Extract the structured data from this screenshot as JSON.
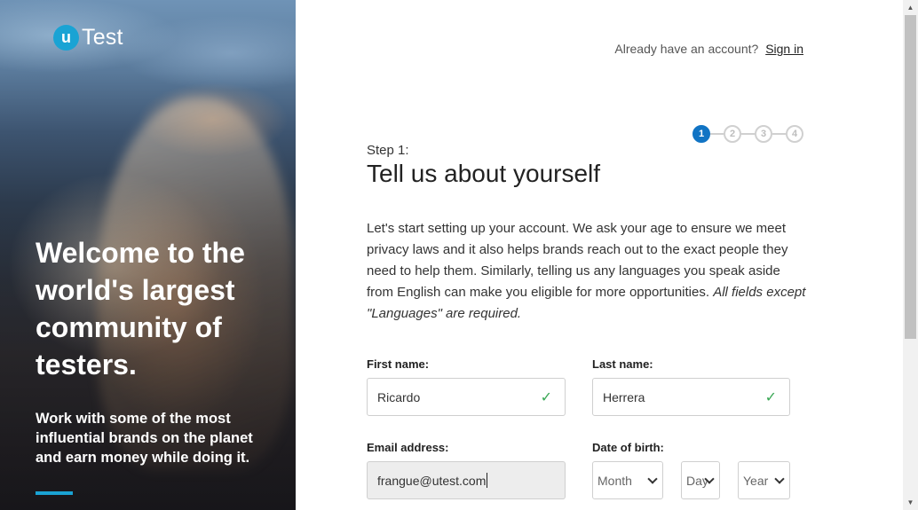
{
  "brand": {
    "logo_mark": "u",
    "logo_text": "Test",
    "accent_color": "#1aa3d4"
  },
  "hero": {
    "title": "Welcome to the world's largest community of testers.",
    "subtitle": "Work with some of the most influential brands on the planet and earn money while doing it."
  },
  "header": {
    "question": "Already have an account?",
    "sign_in": "Sign in"
  },
  "stepper": {
    "steps": [
      "1",
      "2",
      "3",
      "4"
    ],
    "current": 1,
    "active_color": "#1174c4"
  },
  "form": {
    "step_label": "Step 1:",
    "title": "Tell us about yourself",
    "intro": "Let's start setting up your account. We ask your age to ensure we meet privacy laws and it also helps brands reach out to the exact people they need to help them. Similarly, telling us any languages you speak aside from English can make you eligible for more opportunities.",
    "intro_note": "All fields except \"Languages\" are required.",
    "first_name": {
      "label": "First name:",
      "value": "Ricardo",
      "valid_icon": "checkmark-icon"
    },
    "last_name": {
      "label": "Last name:",
      "value": "Herrera",
      "valid_icon": "checkmark-icon"
    },
    "email": {
      "label": "Email address:",
      "value": "frangue@utest.com"
    },
    "dob": {
      "label": "Date of birth:",
      "month": "Month",
      "day": "Day",
      "year": "Year"
    }
  },
  "valid_color": "#3aa855"
}
